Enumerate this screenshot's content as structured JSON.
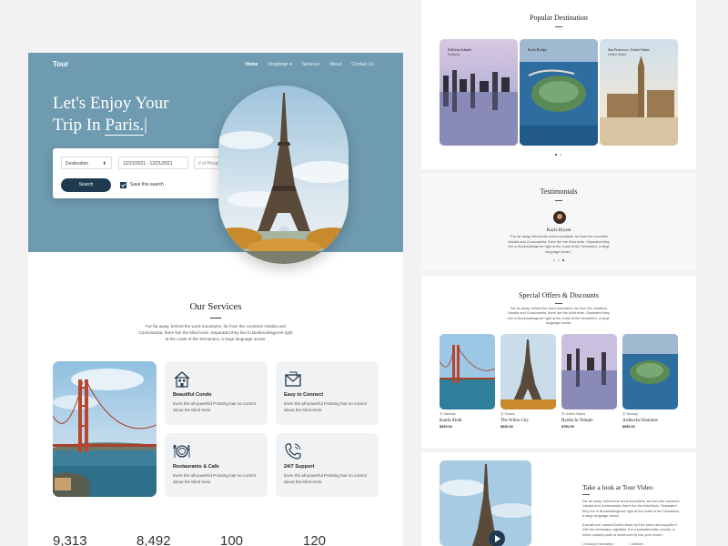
{
  "left": {
    "header": {
      "logo": "Tour",
      "nav": [
        "Home",
        "Dropdown",
        "Services",
        "About",
        "Contact Us"
      ]
    },
    "hero": {
      "title_line1": "Let's Enjoy Your",
      "title_line2_prefix": "Trip In ",
      "title_line2_highlight": "Paris."
    },
    "search": {
      "destination": "Destination",
      "dates": "12/21/2021 - 12/21/2021",
      "people_placeholder": "# of People",
      "button": "Search",
      "save_label": "Save this search"
    },
    "services": {
      "title": "Our Services",
      "description": "Far far away, behind the word mountains, far from the countries Vokalia and Consonantia, there live the blind texts. Separated they live in Bookmarksgrove right at the coast of the Semantics, a large language ocean.",
      "items": [
        {
          "title": "Beautiful Condo",
          "text": "Even the all-powerful Pointing has no control about the blind texts.",
          "icon": "building-icon"
        },
        {
          "title": "Easy to Connect",
          "text": "Even the all-powerful Pointing has no control about the blind texts.",
          "icon": "envelope-icon"
        },
        {
          "title": "Restaurants & Cafe",
          "text": "Even the all-powerful Pointing has no control about the blind texts.",
          "icon": "dining-icon"
        },
        {
          "title": "24/7 Support",
          "text": "Even the all-powerful Pointing has no control about the blind texts.",
          "icon": "phone-icon"
        }
      ]
    },
    "stats": [
      "9,313",
      "8,492",
      "100",
      "120"
    ]
  },
  "right": {
    "popular": {
      "title": "Popular Destination",
      "cards": [
        {
          "name": "Pulletsia Islands",
          "sub": "Malaysia"
        },
        {
          "name": "Rodo Bridge",
          "sub": ""
        },
        {
          "name": "San Francisco, United States",
          "sub": "United States"
        }
      ]
    },
    "testimonials": {
      "title": "Testimonials",
      "name": "Kayla Bryant",
      "quote": "“Far far away, behind the word mountains, far from the countries Vokalia and Consonantia, there live the blind texts. Separated they live in Bookmarksgrove right at the coast of the Semantics, a large language ocean.”"
    },
    "offers": {
      "title": "Special Offers & Discounts",
      "description": "Far far away, behind the word mountains, far from the countries Vokalia and Consonantia, there live the blind texts. Separated they live in Bookmarksgrove right at the coast of the Semantics, a large language ocean.",
      "cards": [
        {
          "location": "Marinas",
          "name": "Kaufa Alodi",
          "price": "$529.00"
        },
        {
          "location": "Towers",
          "name": "The White City",
          "price": "$530.00"
        },
        {
          "location": "United States",
          "name": "Byedu In Temple",
          "price": "$790.00"
        },
        {
          "location": "Norway",
          "name": "Arditzche Emirates",
          "price": "$530.00"
        }
      ]
    },
    "video": {
      "title": "Take a look at Tour Video",
      "para1": "Far far away, behind the word mountains, far from the countries Vokalia and Consonantia, there live the blind texts. Separated they live in Bookmarksgrove right at the coast of the Semantics, a large language ocean.",
      "para2": "A small river named Duden flows by their place and supplies it with the necessary regelialia. It is a paradisematic country, in which roasted parts of sentences fly into your mouth.",
      "features": [
        "Outdoor recreation",
        "Airlines"
      ]
    }
  }
}
